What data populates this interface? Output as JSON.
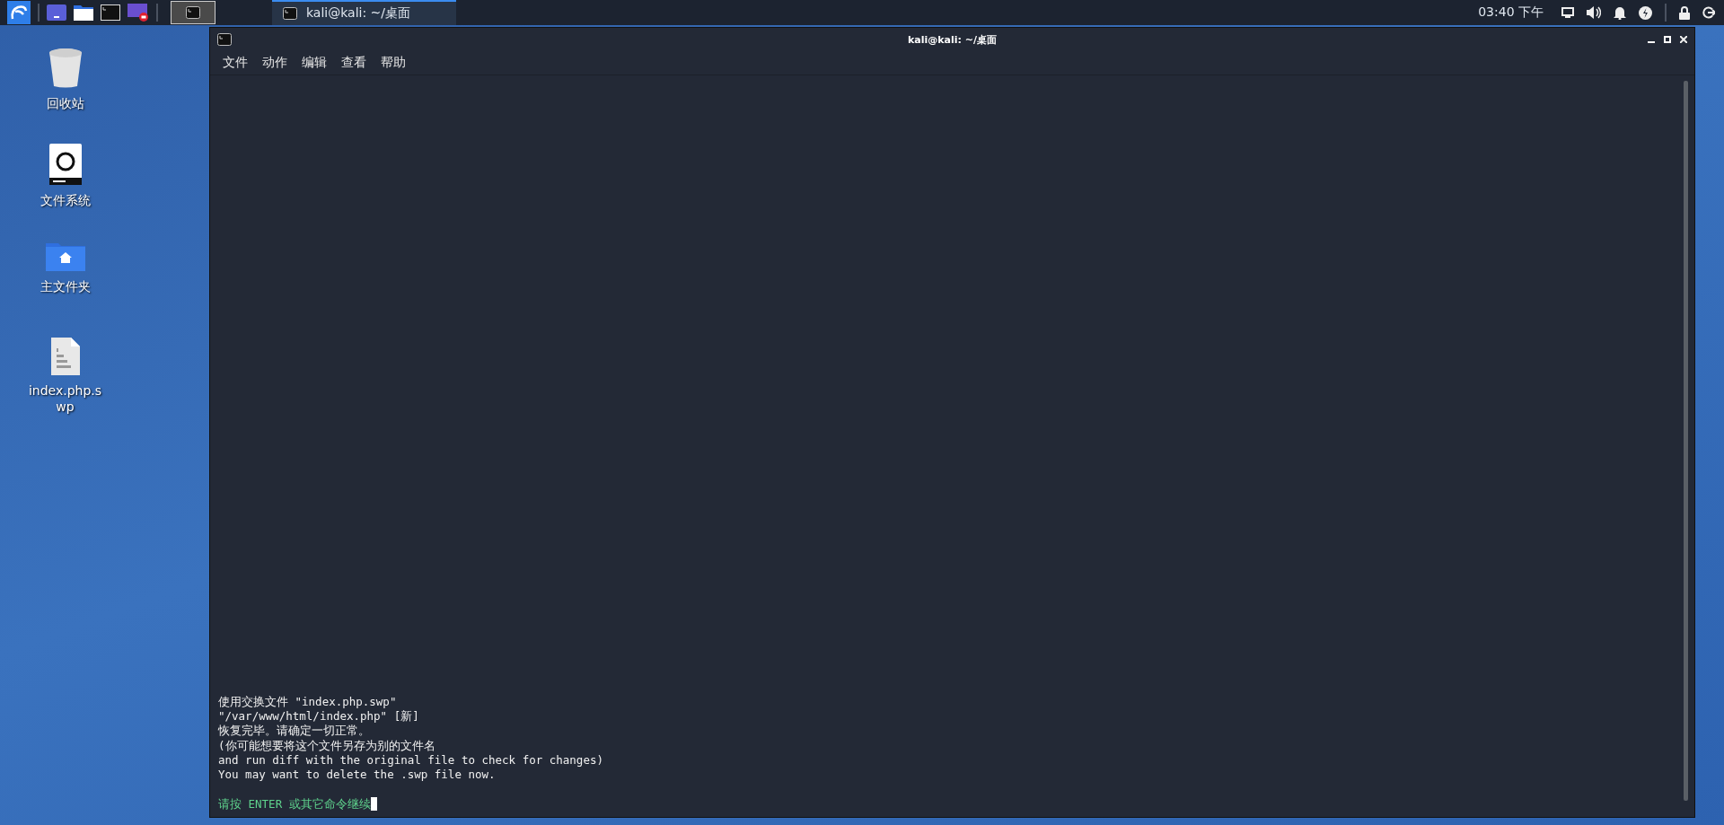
{
  "taskbar": {
    "workspaces": [
      {
        "selected": true
      }
    ],
    "tasks": [
      {
        "title": "kali@kali: ~/桌面",
        "selected": true
      }
    ],
    "clock": "03:40 下午"
  },
  "desktop_icons": [
    {
      "label": "回收站",
      "kind": "trash"
    },
    {
      "label": "文件系统",
      "kind": "drive"
    },
    {
      "label": "主文件夹",
      "kind": "home"
    },
    {
      "label": "index.php.swp",
      "kind": "file"
    }
  ],
  "window": {
    "title": "kali@kali: ~/桌面",
    "menu": [
      "文件",
      "动作",
      "编辑",
      "查看",
      "帮助"
    ],
    "lines": [
      "使用交换文件 \"index.php.swp\"",
      "\"/var/www/html/index.php\" [新]",
      "恢复完毕。请确定一切正常。",
      "(你可能想要将这个文件另存为别的文件名",
      "and run diff with the original file to check for changes)",
      "You may want to delete the .swp file now."
    ],
    "prompt": {
      "text": "请按 ENTER 或其它命令继续",
      "cursor": true
    }
  }
}
